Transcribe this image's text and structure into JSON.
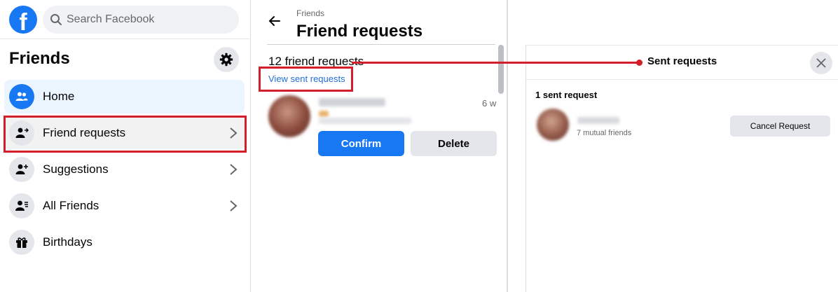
{
  "search": {
    "placeholder": "Search Facebook"
  },
  "sidebar": {
    "title": "Friends",
    "items": [
      {
        "label": "Home",
        "icon": "friends-home-icon"
      },
      {
        "label": "Friend requests",
        "icon": "person-add-icon"
      },
      {
        "label": "Suggestions",
        "icon": "person-plus-icon"
      },
      {
        "label": "All Friends",
        "icon": "person-list-icon"
      },
      {
        "label": "Birthdays",
        "icon": "gift-icon"
      }
    ]
  },
  "middle": {
    "breadcrumb": "Friends",
    "title": "Friend requests",
    "count": "12 friend requests",
    "view_sent_link": "View sent requests",
    "request": {
      "time": "6 w",
      "confirm_label": "Confirm",
      "delete_label": "Delete"
    }
  },
  "dialog": {
    "title": "Sent requests",
    "count": "1 sent request",
    "item": {
      "mutual": "7 mutual friends",
      "cancel_label": "Cancel Request"
    }
  },
  "colors": {
    "brand": "#1877f2",
    "annotation": "#d21f2b",
    "link": "#216fdb"
  }
}
